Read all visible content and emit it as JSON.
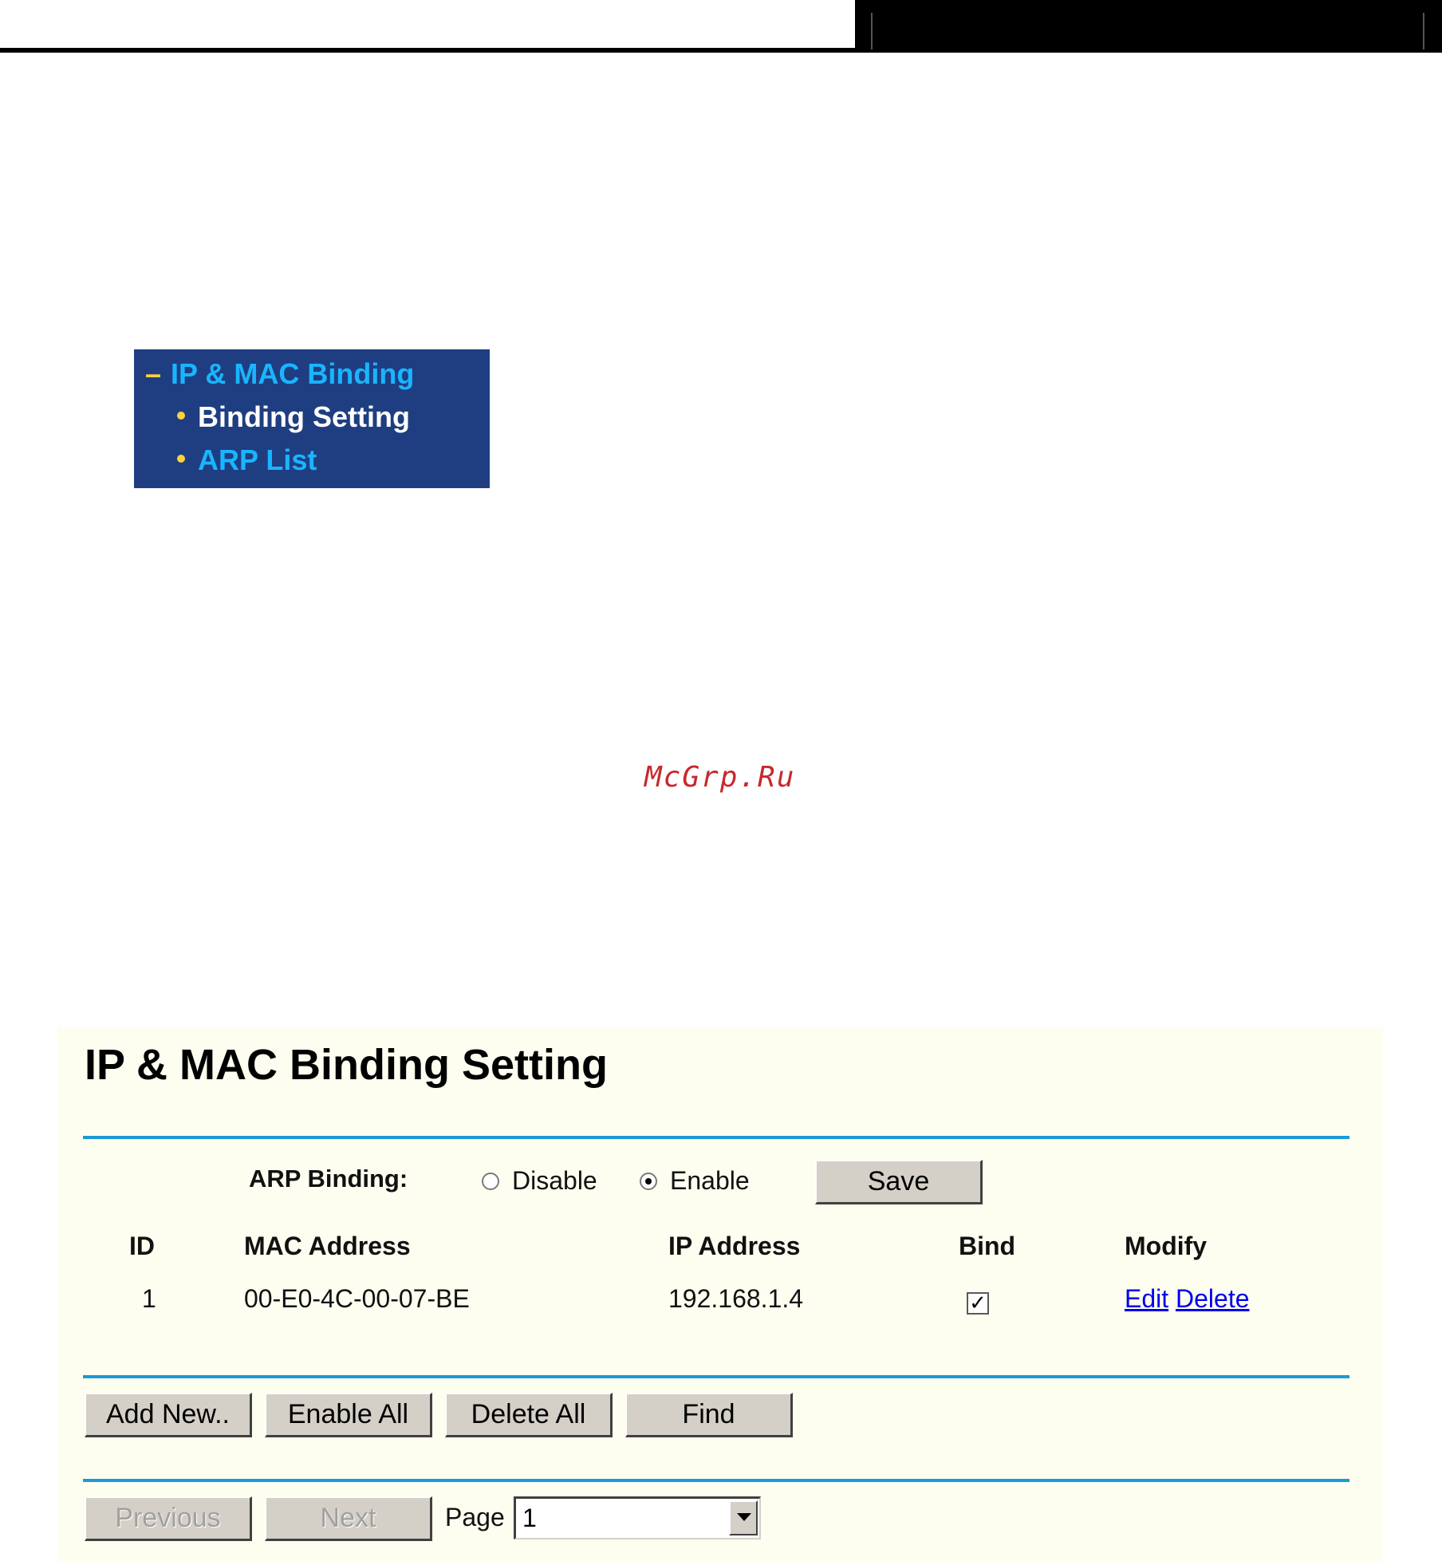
{
  "menu": {
    "parent_prefix": "–",
    "parent_label": "IP & MAC Binding",
    "items": [
      {
        "label": "Binding Setting",
        "active": true
      },
      {
        "label": "ARP List",
        "active": false
      }
    ]
  },
  "watermark": "McGrp.Ru",
  "panel": {
    "title": "IP & MAC Binding Setting",
    "arp_binding_label": "ARP Binding:",
    "radio_options": [
      {
        "label": "Disable",
        "checked": false
      },
      {
        "label": "Enable",
        "checked": true
      }
    ],
    "save_label": "Save",
    "columns": [
      "ID",
      "MAC Address",
      "IP Address",
      "Bind",
      "Modify"
    ],
    "rows": [
      {
        "id": "1",
        "mac": "00-E0-4C-00-07-BE",
        "ip": "192.168.1.4",
        "bind": true,
        "edit": "Edit",
        "delete": "Delete"
      }
    ],
    "buttons": {
      "add_new": "Add New..",
      "enable_all": "Enable All",
      "delete_all": "Delete All",
      "find": "Find"
    },
    "pager": {
      "previous": "Previous",
      "next": "Next",
      "page_label": "Page",
      "page_value": "1"
    }
  },
  "colors": {
    "menu_bg": "#1f3e82",
    "menu_link": "#19b5ff",
    "menu_bullet": "#ffd23c",
    "panel_bg": "#fdfdf0",
    "divider": "#1a9ad6",
    "watermark": "#c8282c"
  }
}
